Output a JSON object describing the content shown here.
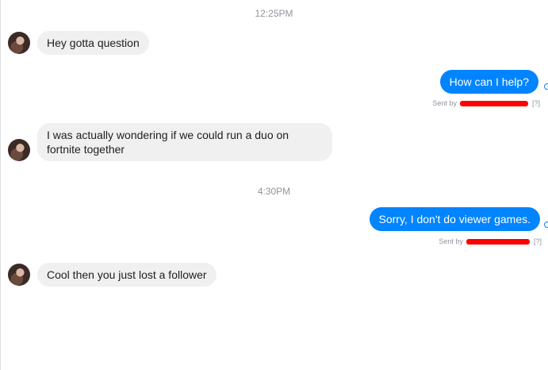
{
  "thread": {
    "timestamps": [
      "12:25PM",
      "4:30PM"
    ],
    "messages": [
      {
        "text": "Hey gotta question"
      },
      {
        "text": "How can I help?",
        "sent_by": "Sent by",
        "suffix": "[?]"
      },
      {
        "line1": "I was actually wondering if we could run a duo on",
        "line2": "fortnite together"
      },
      {
        "text": "Sorry, I don't do viewer games.",
        "sent_by": "Sent by",
        "suffix": "[?]"
      },
      {
        "text": "Cool then you just lost a follower"
      }
    ]
  },
  "colors": {
    "outgoing_bubble": "#0084ff",
    "incoming_bubble": "#f1f0f0",
    "redaction": "#ff0000"
  }
}
